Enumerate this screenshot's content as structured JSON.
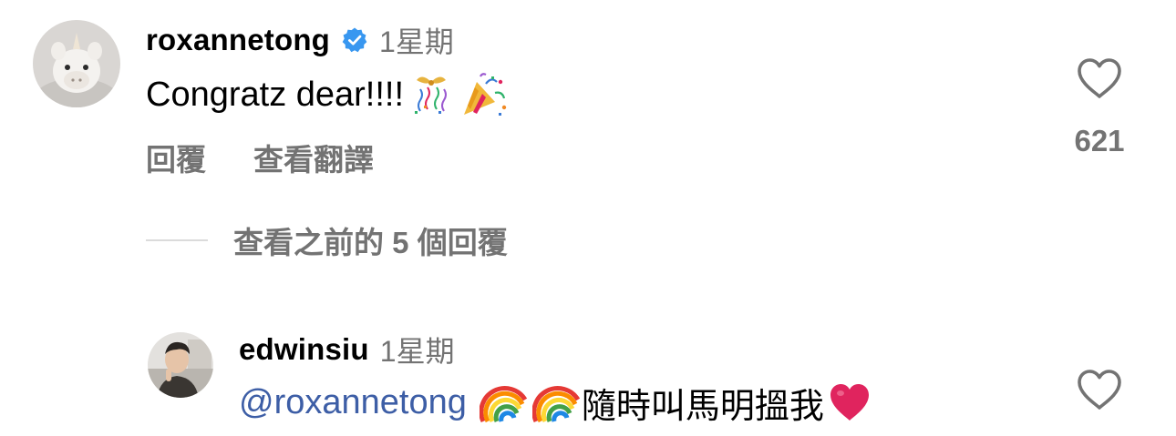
{
  "comments": [
    {
      "username": "roxannetong",
      "verified": true,
      "time": "1星期",
      "text": "Congratz dear!!!!",
      "emojis": [
        "confetti-ball-icon",
        "party-popper-icon"
      ],
      "likes": "621",
      "actions": {
        "reply": "回覆",
        "translate": "查看翻譯"
      },
      "view_replies": "查看之前的 5 個回覆"
    },
    {
      "username": "edwinsiu",
      "verified": false,
      "time": "1星期",
      "mention": "@roxannetong",
      "text": "隨時叫馬明搵我",
      "emojis": [
        "rainbow-icon",
        "rainbow-icon",
        "red-heart-icon"
      ]
    }
  ],
  "colors": {
    "text": "#000000",
    "muted": "#737373",
    "mention": "#3d5ea6",
    "verified": "#3897f0",
    "divider": "#dbdbdb",
    "heart_emoji": "#e0245e"
  }
}
